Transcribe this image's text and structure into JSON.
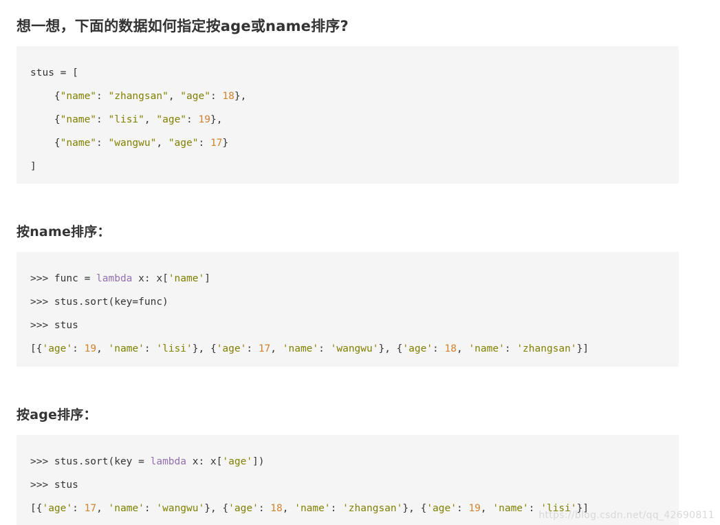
{
  "headings": {
    "main": "想一想，下面的数据如何指定按age或name排序?",
    "sort_by_name": "按name排序：",
    "sort_by_age": "按age排序："
  },
  "colors": {
    "code_background": "#f5f5f5",
    "page_background": "#ffffff",
    "text": "#333333",
    "string": "#808000",
    "number": "#d2822c",
    "keyword": "#9370b0",
    "watermark": "#d8d8d8"
  },
  "code_blocks": [
    {
      "id": "data",
      "lines": [
        [
          {
            "t": "stus = [",
            "c": "plain"
          }
        ],
        [
          {
            "t": "    {",
            "c": "plain"
          },
          {
            "t": "\"name\"",
            "c": "str"
          },
          {
            "t": ": ",
            "c": "plain"
          },
          {
            "t": "\"zhangsan\"",
            "c": "str"
          },
          {
            "t": ", ",
            "c": "plain"
          },
          {
            "t": "\"age\"",
            "c": "str"
          },
          {
            "t": ": ",
            "c": "plain"
          },
          {
            "t": "18",
            "c": "num"
          },
          {
            "t": "},",
            "c": "plain"
          }
        ],
        [
          {
            "t": "    {",
            "c": "plain"
          },
          {
            "t": "\"name\"",
            "c": "str"
          },
          {
            "t": ": ",
            "c": "plain"
          },
          {
            "t": "\"lisi\"",
            "c": "str"
          },
          {
            "t": ", ",
            "c": "plain"
          },
          {
            "t": "\"age\"",
            "c": "str"
          },
          {
            "t": ": ",
            "c": "plain"
          },
          {
            "t": "19",
            "c": "num"
          },
          {
            "t": "},",
            "c": "plain"
          }
        ],
        [
          {
            "t": "    {",
            "c": "plain"
          },
          {
            "t": "\"name\"",
            "c": "str"
          },
          {
            "t": ": ",
            "c": "plain"
          },
          {
            "t": "\"wangwu\"",
            "c": "str"
          },
          {
            "t": ", ",
            "c": "plain"
          },
          {
            "t": "\"age\"",
            "c": "str"
          },
          {
            "t": ": ",
            "c": "plain"
          },
          {
            "t": "17",
            "c": "num"
          },
          {
            "t": "}",
            "c": "plain"
          }
        ],
        [
          {
            "t": "]",
            "c": "plain"
          }
        ]
      ]
    },
    {
      "id": "name",
      "lines": [
        [
          {
            "t": ">>> func = ",
            "c": "plain"
          },
          {
            "t": "lambda",
            "c": "kw"
          },
          {
            "t": " x: x[",
            "c": "plain"
          },
          {
            "t": "'name'",
            "c": "str"
          },
          {
            "t": "]",
            "c": "plain"
          }
        ],
        [
          {
            "t": ">>> stus.sort(key=func)",
            "c": "plain"
          }
        ],
        [
          {
            "t": ">>> stus",
            "c": "plain"
          }
        ],
        [
          {
            "t": "[{",
            "c": "plain"
          },
          {
            "t": "'age'",
            "c": "str"
          },
          {
            "t": ": ",
            "c": "plain"
          },
          {
            "t": "19",
            "c": "num"
          },
          {
            "t": ", ",
            "c": "plain"
          },
          {
            "t": "'name'",
            "c": "str"
          },
          {
            "t": ": ",
            "c": "plain"
          },
          {
            "t": "'lisi'",
            "c": "str"
          },
          {
            "t": "}, {",
            "c": "plain"
          },
          {
            "t": "'age'",
            "c": "str"
          },
          {
            "t": ": ",
            "c": "plain"
          },
          {
            "t": "17",
            "c": "num"
          },
          {
            "t": ", ",
            "c": "plain"
          },
          {
            "t": "'name'",
            "c": "str"
          },
          {
            "t": ": ",
            "c": "plain"
          },
          {
            "t": "'wangwu'",
            "c": "str"
          },
          {
            "t": "}, {",
            "c": "plain"
          },
          {
            "t": "'age'",
            "c": "str"
          },
          {
            "t": ": ",
            "c": "plain"
          },
          {
            "t": "18",
            "c": "num"
          },
          {
            "t": ", ",
            "c": "plain"
          },
          {
            "t": "'name'",
            "c": "str"
          },
          {
            "t": ": ",
            "c": "plain"
          },
          {
            "t": "'zhangsan'",
            "c": "str"
          },
          {
            "t": "}]",
            "c": "plain"
          }
        ]
      ]
    },
    {
      "id": "age",
      "lines": [
        [
          {
            "t": ">>> stus.sort(key = ",
            "c": "plain"
          },
          {
            "t": "lambda",
            "c": "kw"
          },
          {
            "t": " x: x[",
            "c": "plain"
          },
          {
            "t": "'age'",
            "c": "str"
          },
          {
            "t": "])",
            "c": "plain"
          }
        ],
        [
          {
            "t": ">>> stus",
            "c": "plain"
          }
        ],
        [
          {
            "t": "[{",
            "c": "plain"
          },
          {
            "t": "'age'",
            "c": "str"
          },
          {
            "t": ": ",
            "c": "plain"
          },
          {
            "t": "17",
            "c": "num"
          },
          {
            "t": ", ",
            "c": "plain"
          },
          {
            "t": "'name'",
            "c": "str"
          },
          {
            "t": ": ",
            "c": "plain"
          },
          {
            "t": "'wangwu'",
            "c": "str"
          },
          {
            "t": "}, {",
            "c": "plain"
          },
          {
            "t": "'age'",
            "c": "str"
          },
          {
            "t": ": ",
            "c": "plain"
          },
          {
            "t": "18",
            "c": "num"
          },
          {
            "t": ", ",
            "c": "plain"
          },
          {
            "t": "'name'",
            "c": "str"
          },
          {
            "t": ": ",
            "c": "plain"
          },
          {
            "t": "'zhangsan'",
            "c": "str"
          },
          {
            "t": "}, {",
            "c": "plain"
          },
          {
            "t": "'age'",
            "c": "str"
          },
          {
            "t": ": ",
            "c": "plain"
          },
          {
            "t": "19",
            "c": "num"
          },
          {
            "t": ", ",
            "c": "plain"
          },
          {
            "t": "'name'",
            "c": "str"
          },
          {
            "t": ": ",
            "c": "plain"
          },
          {
            "t": "'lisi'",
            "c": "str"
          },
          {
            "t": "}]",
            "c": "plain"
          }
        ]
      ]
    }
  ],
  "watermark": "https://blog.csdn.net/qq_42690811"
}
